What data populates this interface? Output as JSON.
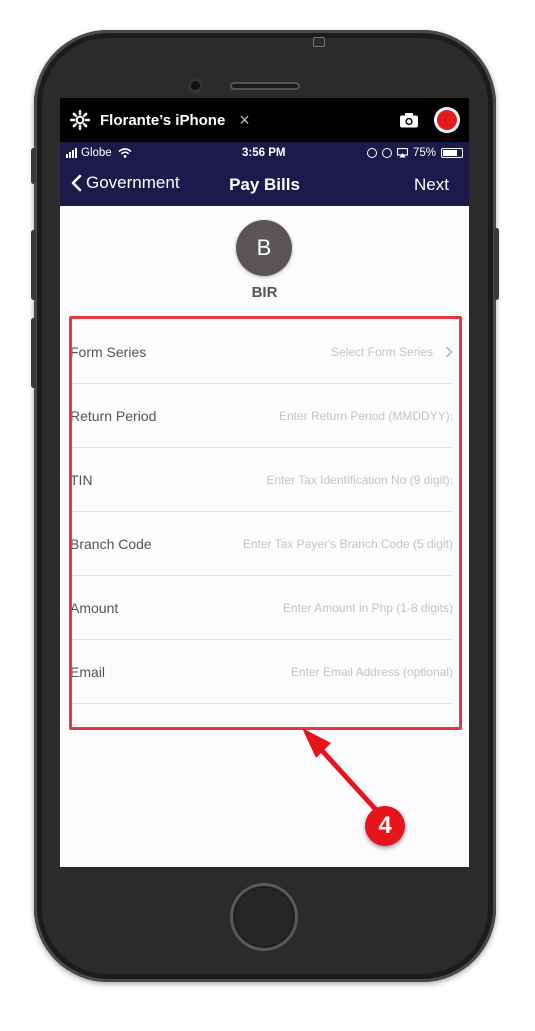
{
  "mirror_bar": {
    "device_name": "Florante’s iPhone",
    "close_symbol": "×"
  },
  "status_bar": {
    "carrier": "Globe",
    "time": "3:56 PM",
    "battery": "75%",
    "battery_level": 0.75
  },
  "nav": {
    "back_label": "Government",
    "title": "Pay Bills",
    "next_label": "Next",
    "bar_color": "#1c1a4a"
  },
  "biller": {
    "initial": "B",
    "name": "BIR"
  },
  "form": {
    "rows": [
      {
        "label": "Form Series",
        "placeholder": "Select Form Series"
      },
      {
        "label": "Return Period",
        "placeholder": "Enter Return Period (MMDDYY):"
      },
      {
        "label": "TIN",
        "placeholder": "Enter Tax Identification No (9 digit):"
      },
      {
        "label": "Branch Code",
        "placeholder": "Enter Tax Payer's Branch Code (5 digit)"
      },
      {
        "label": "Amount",
        "placeholder": "Enter Amount in Php (1-8 digits)"
      },
      {
        "label": "Email",
        "placeholder": "Enter Email Address (optional)"
      }
    ]
  },
  "annotation": {
    "step_number": "4",
    "color": "#e8353f"
  }
}
